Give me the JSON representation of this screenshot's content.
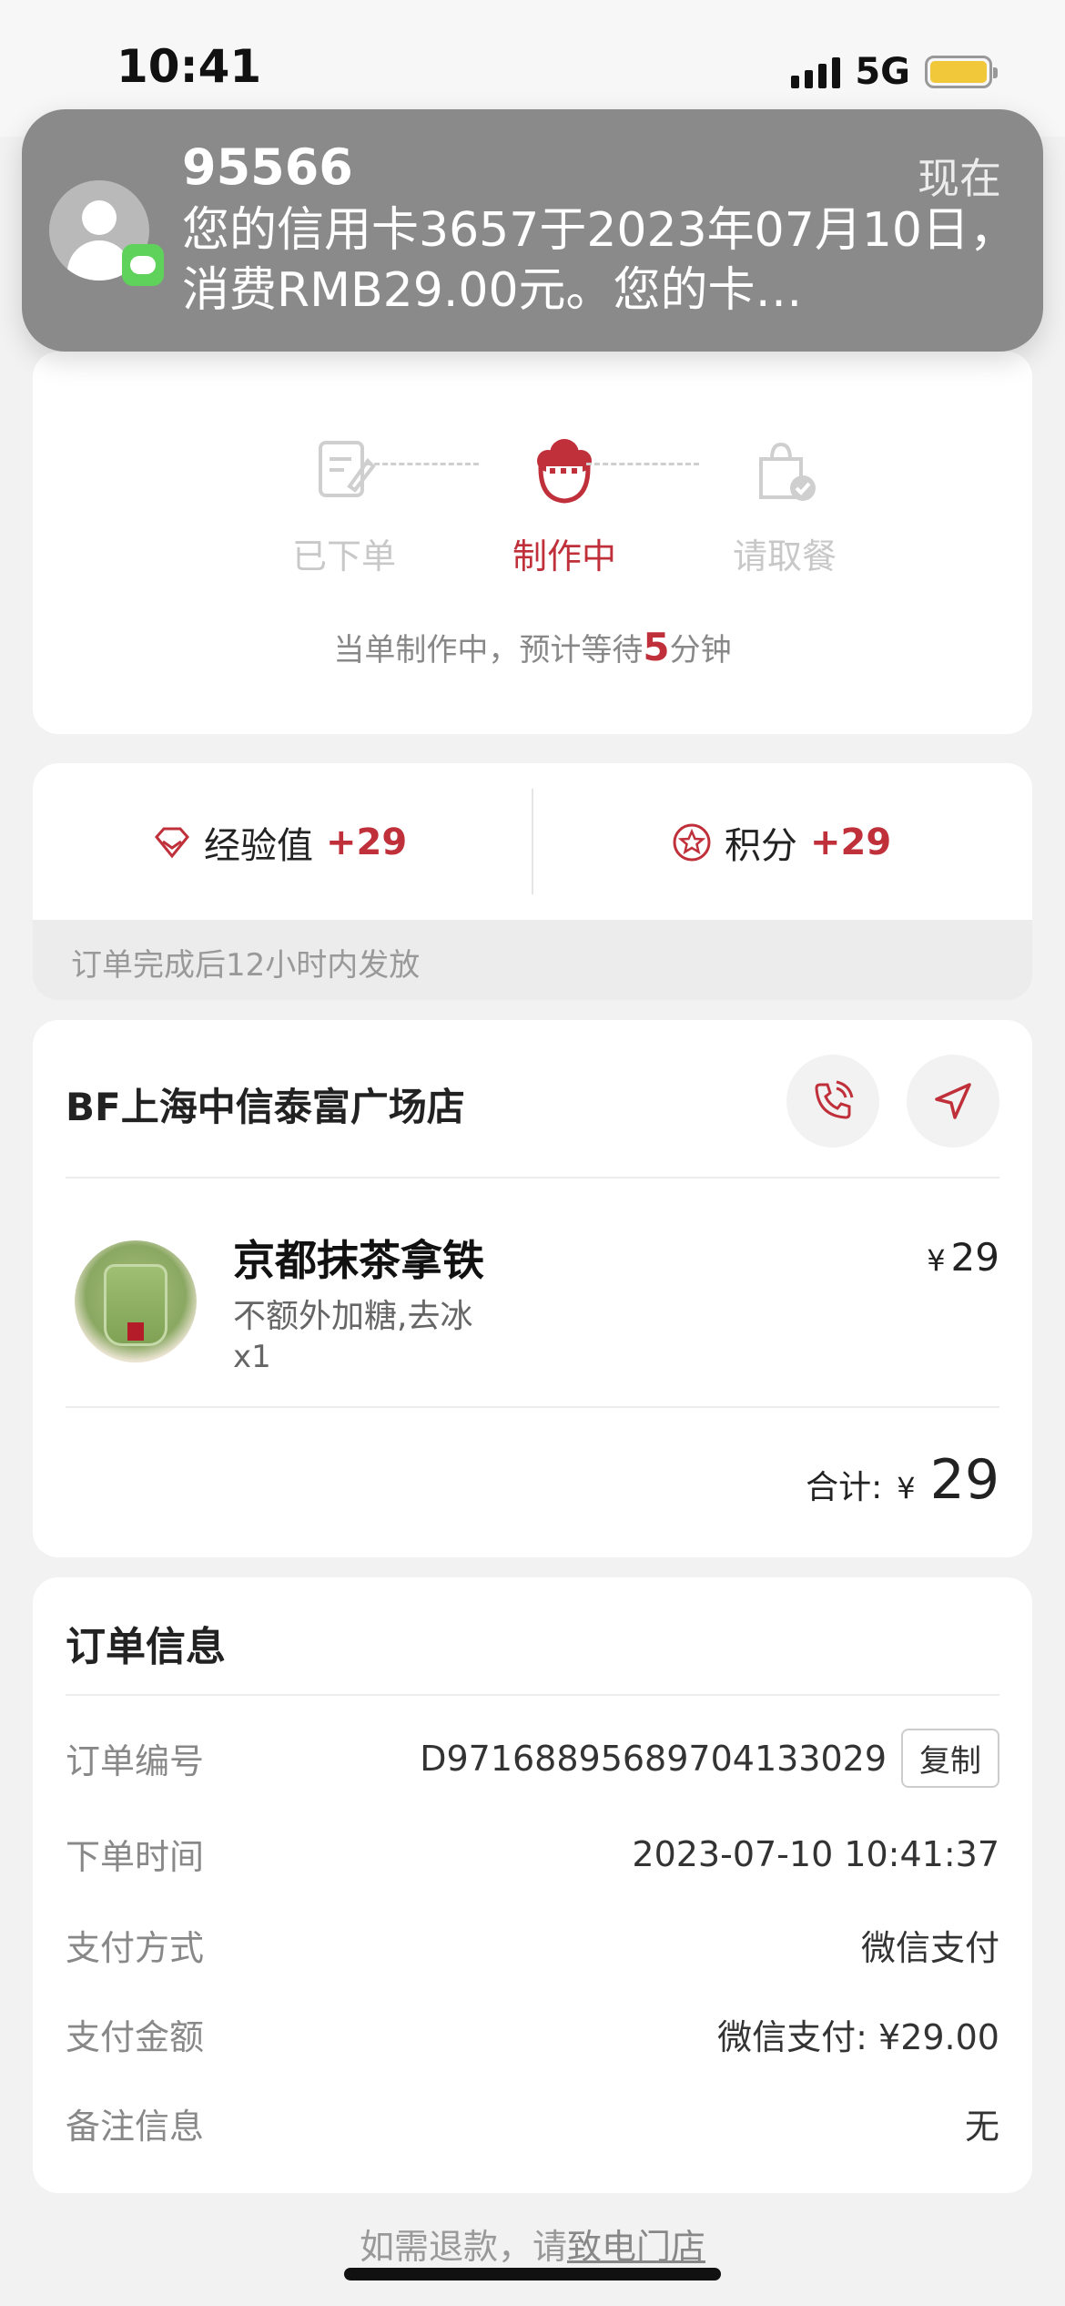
{
  "status_bar": {
    "time": "10:41",
    "network": "5G"
  },
  "notification": {
    "sender": "95566",
    "time": "现在",
    "text": "您的信用卡3657于2023年07月10日，消费RMB29.00元。您的卡…"
  },
  "progress": {
    "steps": [
      {
        "label": "已下单",
        "state": "done"
      },
      {
        "label": "制作中",
        "state": "active"
      },
      {
        "label": "请取餐",
        "state": "pending"
      }
    ],
    "wait_prefix": "当单制作中，预计等待",
    "wait_minutes": "5",
    "wait_suffix": "分钟"
  },
  "rewards": {
    "exp_label": "经验值",
    "exp_value": "+29",
    "points_label": "积分",
    "points_value": "+29",
    "note": "订单完成后12小时内发放"
  },
  "store": {
    "name": "BF上海中信泰富广场店",
    "product": {
      "name": "京都抹茶拿铁",
      "options": "不额外加糖,去冰",
      "qty": "x1",
      "currency": "¥",
      "price": "29"
    },
    "total_label": "合计:",
    "total_currency": "¥",
    "total_value": "29"
  },
  "order_info": {
    "title": "订单信息",
    "rows": [
      {
        "key": "订单编号",
        "value": "D9716889568970413302​9"
      },
      {
        "key": "下单时间",
        "value": "2023-07-10 10:41:37"
      },
      {
        "key": "支付方式",
        "value": "微信支付"
      },
      {
        "key": "支付金额",
        "value": "微信支付: ¥29.00"
      },
      {
        "key": "备注信息",
        "value": "无"
      }
    ],
    "copy_label": "复制"
  },
  "footer": {
    "refund_prefix": "如需退款，请",
    "refund_link": "致电门店"
  },
  "colors": {
    "accent": "#c0303a",
    "background": "#f2f2f2"
  }
}
